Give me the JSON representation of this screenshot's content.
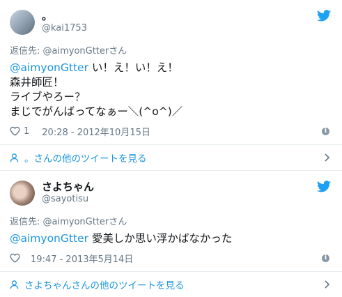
{
  "colors": {
    "link": "#1b95e0",
    "muted": "#657786",
    "text": "#14171a"
  },
  "tweets": [
    {
      "display_name": "。",
      "handle": "@kai1753",
      "avatar_icon": "avatar-photo",
      "reply_label": "返信先: @aimyonGtterさん",
      "mention": "@aimyonGtter",
      "text_after_mention": " い！え！い！え！\n森井師匠！\nライブやろー？\nまじでがんばってなぁー＼(^o^)／",
      "like_count": "1",
      "timestamp": "20:28 - 2012年10月15日",
      "more_link": "。さんの他のツイートを見る"
    },
    {
      "display_name": "さよちゃん",
      "handle": "@sayotisu",
      "avatar_icon": "avatar-photo",
      "reply_label": "返信先: @aimyonGtterさん",
      "mention": "@aimyonGtter",
      "text_after_mention": " 愛美しか思い浮かばなかった",
      "like_count": "",
      "timestamp": "19:47 - 2013年5月14日",
      "more_link": "さよちゃんさんの他のツイートを見る"
    }
  ]
}
